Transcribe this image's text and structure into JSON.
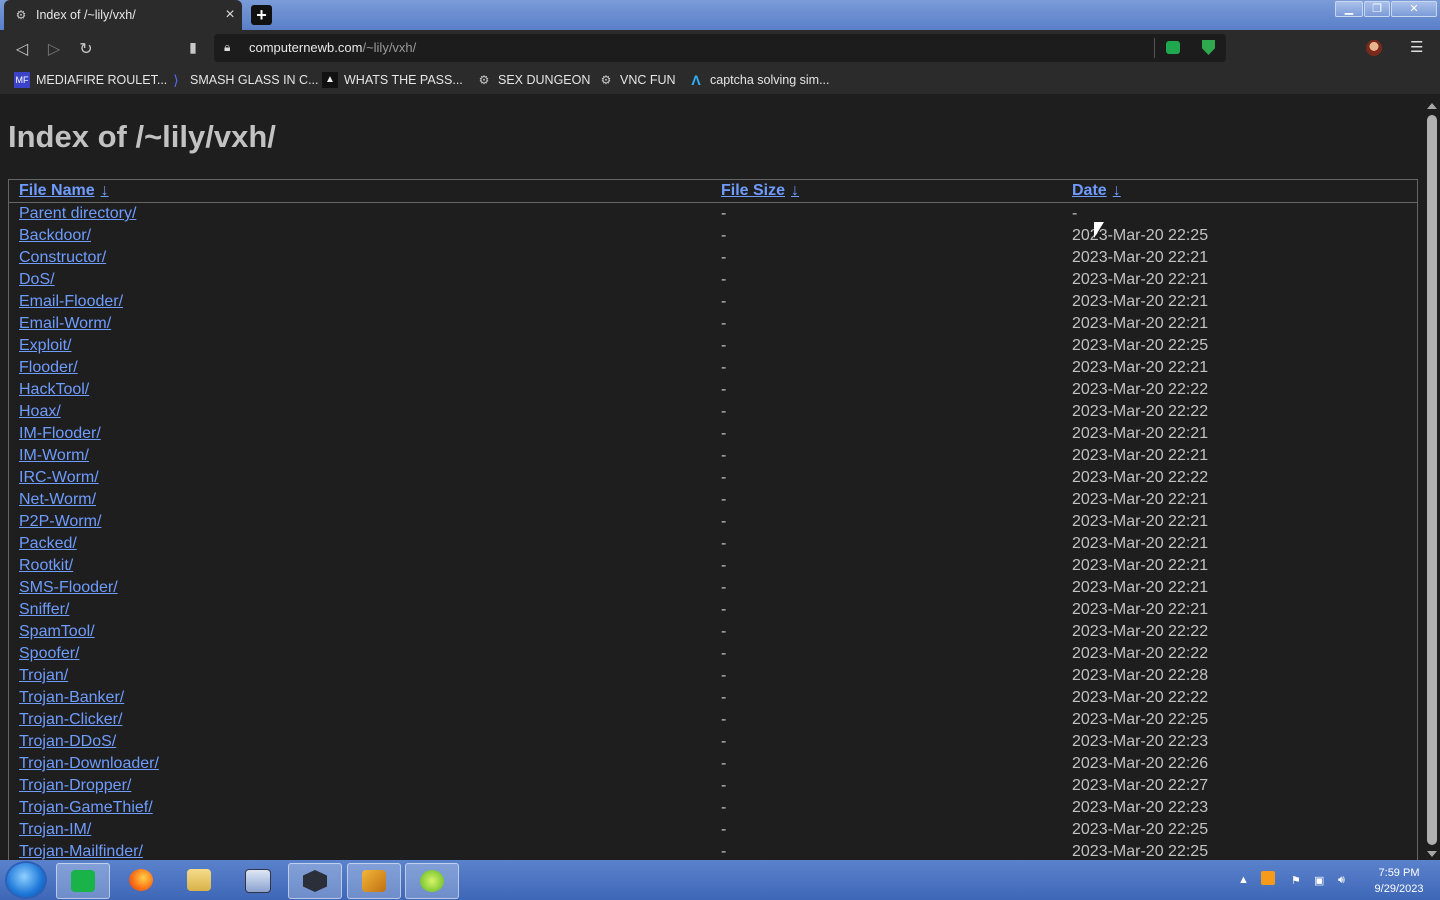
{
  "browser": {
    "tab_title": "Index of /~lily/vxh/",
    "url_host": "computernewb.com",
    "url_path": "/~lily/vxh/",
    "bookmarks": [
      {
        "label": "MEDIAFIRE ROULET...",
        "icon": "mediafire-icon"
      },
      {
        "label": "SMASH GLASS IN C...",
        "icon": "glass-icon"
      },
      {
        "label": "WHATS THE PASS...",
        "icon": "wp-icon"
      },
      {
        "label": "SEX DUNGEON",
        "icon": "vm-icon"
      },
      {
        "label": "VNC FUN",
        "icon": "vm-icon"
      },
      {
        "label": "captcha solving sim...",
        "icon": "captcha-icon"
      }
    ]
  },
  "page": {
    "heading": "Index of /~lily/vxh/",
    "columns": {
      "name": "File Name",
      "size": "File Size",
      "date": "Date",
      "sort_arrow": "↓"
    },
    "rows": [
      {
        "name": "Parent directory/",
        "size": "-",
        "date": "-"
      },
      {
        "name": "Backdoor/",
        "size": "-",
        "date": "2023-Mar-20 22:25"
      },
      {
        "name": "Constructor/",
        "size": "-",
        "date": "2023-Mar-20 22:21"
      },
      {
        "name": "DoS/",
        "size": "-",
        "date": "2023-Mar-20 22:21"
      },
      {
        "name": "Email-Flooder/",
        "size": "-",
        "date": "2023-Mar-20 22:21"
      },
      {
        "name": "Email-Worm/",
        "size": "-",
        "date": "2023-Mar-20 22:21"
      },
      {
        "name": "Exploit/",
        "size": "-",
        "date": "2023-Mar-20 22:25"
      },
      {
        "name": "Flooder/",
        "size": "-",
        "date": "2023-Mar-20 22:21"
      },
      {
        "name": "HackTool/",
        "size": "-",
        "date": "2023-Mar-20 22:22"
      },
      {
        "name": "Hoax/",
        "size": "-",
        "date": "2023-Mar-20 22:22"
      },
      {
        "name": "IM-Flooder/",
        "size": "-",
        "date": "2023-Mar-20 22:21"
      },
      {
        "name": "IM-Worm/",
        "size": "-",
        "date": "2023-Mar-20 22:21"
      },
      {
        "name": "IRC-Worm/",
        "size": "-",
        "date": "2023-Mar-20 22:22"
      },
      {
        "name": "Net-Worm/",
        "size": "-",
        "date": "2023-Mar-20 22:21"
      },
      {
        "name": "P2P-Worm/",
        "size": "-",
        "date": "2023-Mar-20 22:21"
      },
      {
        "name": "Packed/",
        "size": "-",
        "date": "2023-Mar-20 22:21"
      },
      {
        "name": "Rootkit/",
        "size": "-",
        "date": "2023-Mar-20 22:21"
      },
      {
        "name": "SMS-Flooder/",
        "size": "-",
        "date": "2023-Mar-20 22:21"
      },
      {
        "name": "Sniffer/",
        "size": "-",
        "date": "2023-Mar-20 22:21"
      },
      {
        "name": "SpamTool/",
        "size": "-",
        "date": "2023-Mar-20 22:22"
      },
      {
        "name": "Spoofer/",
        "size": "-",
        "date": "2023-Mar-20 22:22"
      },
      {
        "name": "Trojan/",
        "size": "-",
        "date": "2023-Mar-20 22:28"
      },
      {
        "name": "Trojan-Banker/",
        "size": "-",
        "date": "2023-Mar-20 22:22"
      },
      {
        "name": "Trojan-Clicker/",
        "size": "-",
        "date": "2023-Mar-20 22:25"
      },
      {
        "name": "Trojan-DDoS/",
        "size": "-",
        "date": "2023-Mar-20 22:23"
      },
      {
        "name": "Trojan-Downloader/",
        "size": "-",
        "date": "2023-Mar-20 22:26"
      },
      {
        "name": "Trojan-Dropper/",
        "size": "-",
        "date": "2023-Mar-20 22:27"
      },
      {
        "name": "Trojan-GameThief/",
        "size": "-",
        "date": "2023-Mar-20 22:23"
      },
      {
        "name": "Trojan-IM/",
        "size": "-",
        "date": "2023-Mar-20 22:25"
      },
      {
        "name": "Trojan-Mailfinder/",
        "size": "-",
        "date": "2023-Mar-20 22:25"
      }
    ]
  },
  "taskbar": {
    "time": "7:59 PM",
    "date": "9/29/2023"
  },
  "colors": {
    "link": "#6f9cff",
    "text": "#c2c2c2",
    "background": "#1e1e1e"
  }
}
